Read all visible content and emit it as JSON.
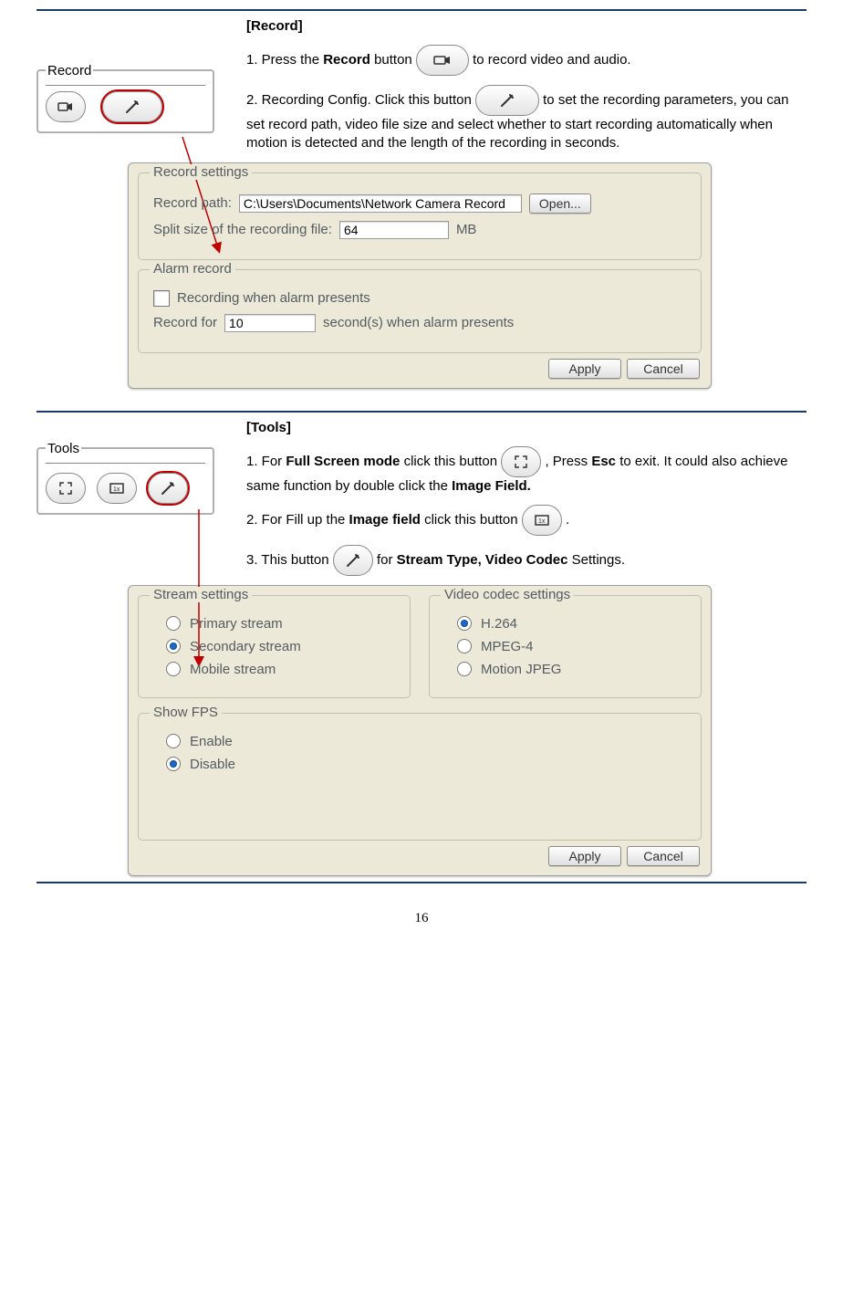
{
  "record": {
    "title": "[Record]",
    "panel_label": "Record",
    "step1_a": "1. Press the ",
    "step1_b": "Record",
    "step1_c": " button ",
    "step1_d": " to record video and audio.",
    "step2_a": "  2. Recording Config. Click this button ",
    "step2_b": " to set the recording parameters, you can set record path, video file size and select whether to start recording automatically when motion is detected and the length of the recording in seconds.",
    "dlg": {
      "legend1": "Record settings",
      "label_path": "Record path:",
      "path_value": "C:\\Users\\Documents\\Network Camera Record",
      "open": "Open...",
      "label_split": "Split size of the recording file:",
      "split_value": "64",
      "mb": "MB",
      "legend2": "Alarm record",
      "check_label": "Recording when alarm presents",
      "record_for": "Record for",
      "seconds_value": "10",
      "seconds_tail": "second(s) when alarm presents",
      "apply": "Apply",
      "cancel": "Cancel"
    }
  },
  "tools": {
    "title": "[Tools]",
    "panel_label": "Tools",
    "step1_a": "  1. For ",
    "step1_b": "Full Screen mode",
    "step1_c": " click this button ",
    "step1_d": " , Press ",
    "step1_e": "Esc",
    "step1_f": " to exit. It could also achieve same function by double click the ",
    "step1_g": "Image Field.",
    "step2_a": "  2. For Fill up the ",
    "step2_b": "Image field",
    "step2_c": " click this button ",
    "step2_d": " .",
    "step3_a": "  3. This button ",
    "step3_b": "  for ",
    "step3_c": "Stream Type, Video Codec",
    "step3_d": " Settings.",
    "dlg": {
      "legend1": "Stream settings",
      "opt_primary": "Primary stream",
      "opt_secondary": "Secondary stream",
      "opt_mobile": "Mobile stream",
      "legend2": "Video codec settings",
      "opt_h264": "H.264",
      "opt_mpeg4": "MPEG-4",
      "opt_mjpeg": "Motion JPEG",
      "legend3": "Show FPS",
      "opt_enable": "Enable",
      "opt_disable": "Disable",
      "apply": "Apply",
      "cancel": "Cancel"
    }
  },
  "page": "16"
}
